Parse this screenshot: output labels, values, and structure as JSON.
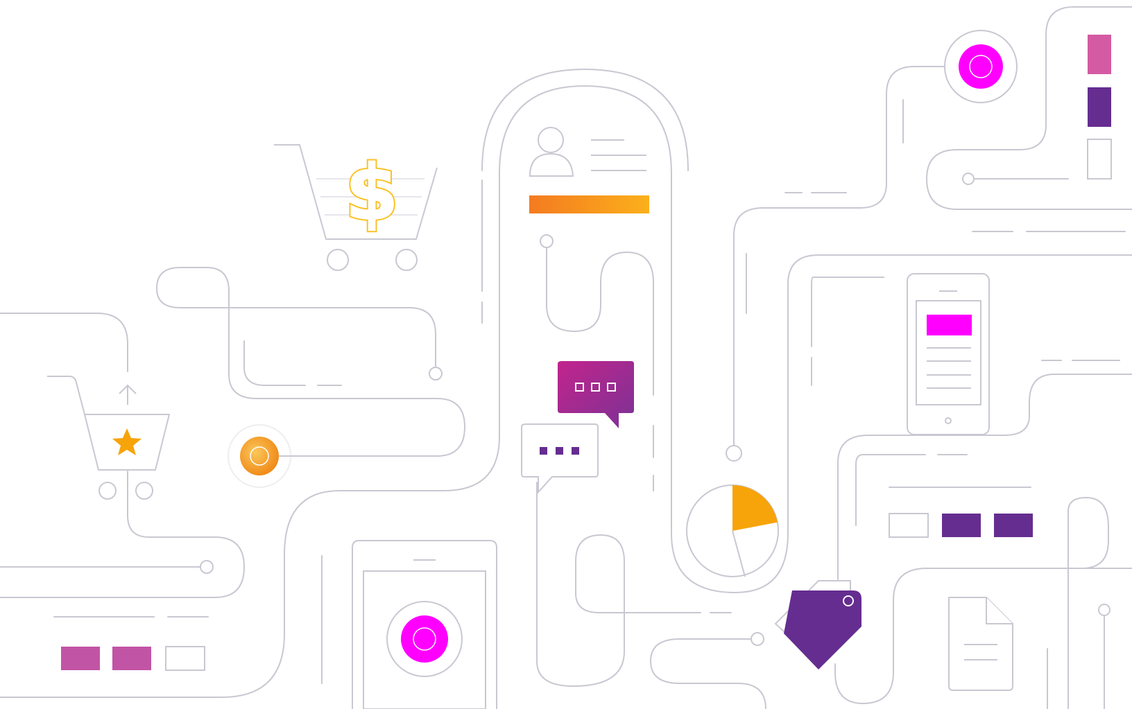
{
  "illustration": {
    "kind": "decorative e-commerce line-art illustration",
    "visible_text": [],
    "colors": {
      "line": "#c8c8d2",
      "background": "#ffffff",
      "magenta": "#ff00ff",
      "orange": "#f39c12",
      "orange_light": "#fbb01c",
      "purple": "#652d90",
      "pink": "#c254a5",
      "pink_light": "#d45ba3",
      "gold": "#fbc226"
    },
    "icons": [
      "shopping-cart-icon",
      "dollar-sign-icon",
      "basket-icon",
      "star-icon",
      "upload-arrow-icon",
      "user-profile-icon",
      "chat-bubble-icon",
      "pie-chart-icon",
      "price-tag-icon",
      "smartphone-icon",
      "tablet-icon",
      "document-icon",
      "target-node-icon"
    ],
    "pie_chart": {
      "highlighted_fraction": 0.22
    },
    "progress_bar": {
      "fill_fraction": 1.0
    }
  }
}
